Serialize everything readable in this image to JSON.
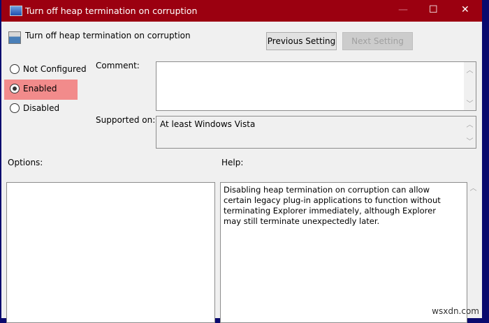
{
  "window": {
    "title": "Turn off heap termination on corruption",
    "minimize": "—",
    "maximize": "☐",
    "close": "✕"
  },
  "header": {
    "setting_title": "Turn off heap termination on corruption",
    "previous_label": "Previous Setting",
    "next_label": "Next Setting"
  },
  "state": {
    "options": [
      {
        "label": "Not Configured",
        "checked": false
      },
      {
        "label": "Enabled",
        "checked": true
      },
      {
        "label": "Disabled",
        "checked": false
      }
    ],
    "highlight": "#f28b8b"
  },
  "comment": {
    "label": "Comment:",
    "value": ""
  },
  "supported": {
    "label": "Supported on:",
    "value": "At least Windows Vista"
  },
  "options_label": "Options:",
  "help": {
    "label": "Help:",
    "text": "Disabling heap termination on corruption can allow certain legacy plug-in applications to function without terminating Explorer immediately, although Explorer may still terminate unexpectedly later."
  },
  "watermark": "wsxdn.com"
}
